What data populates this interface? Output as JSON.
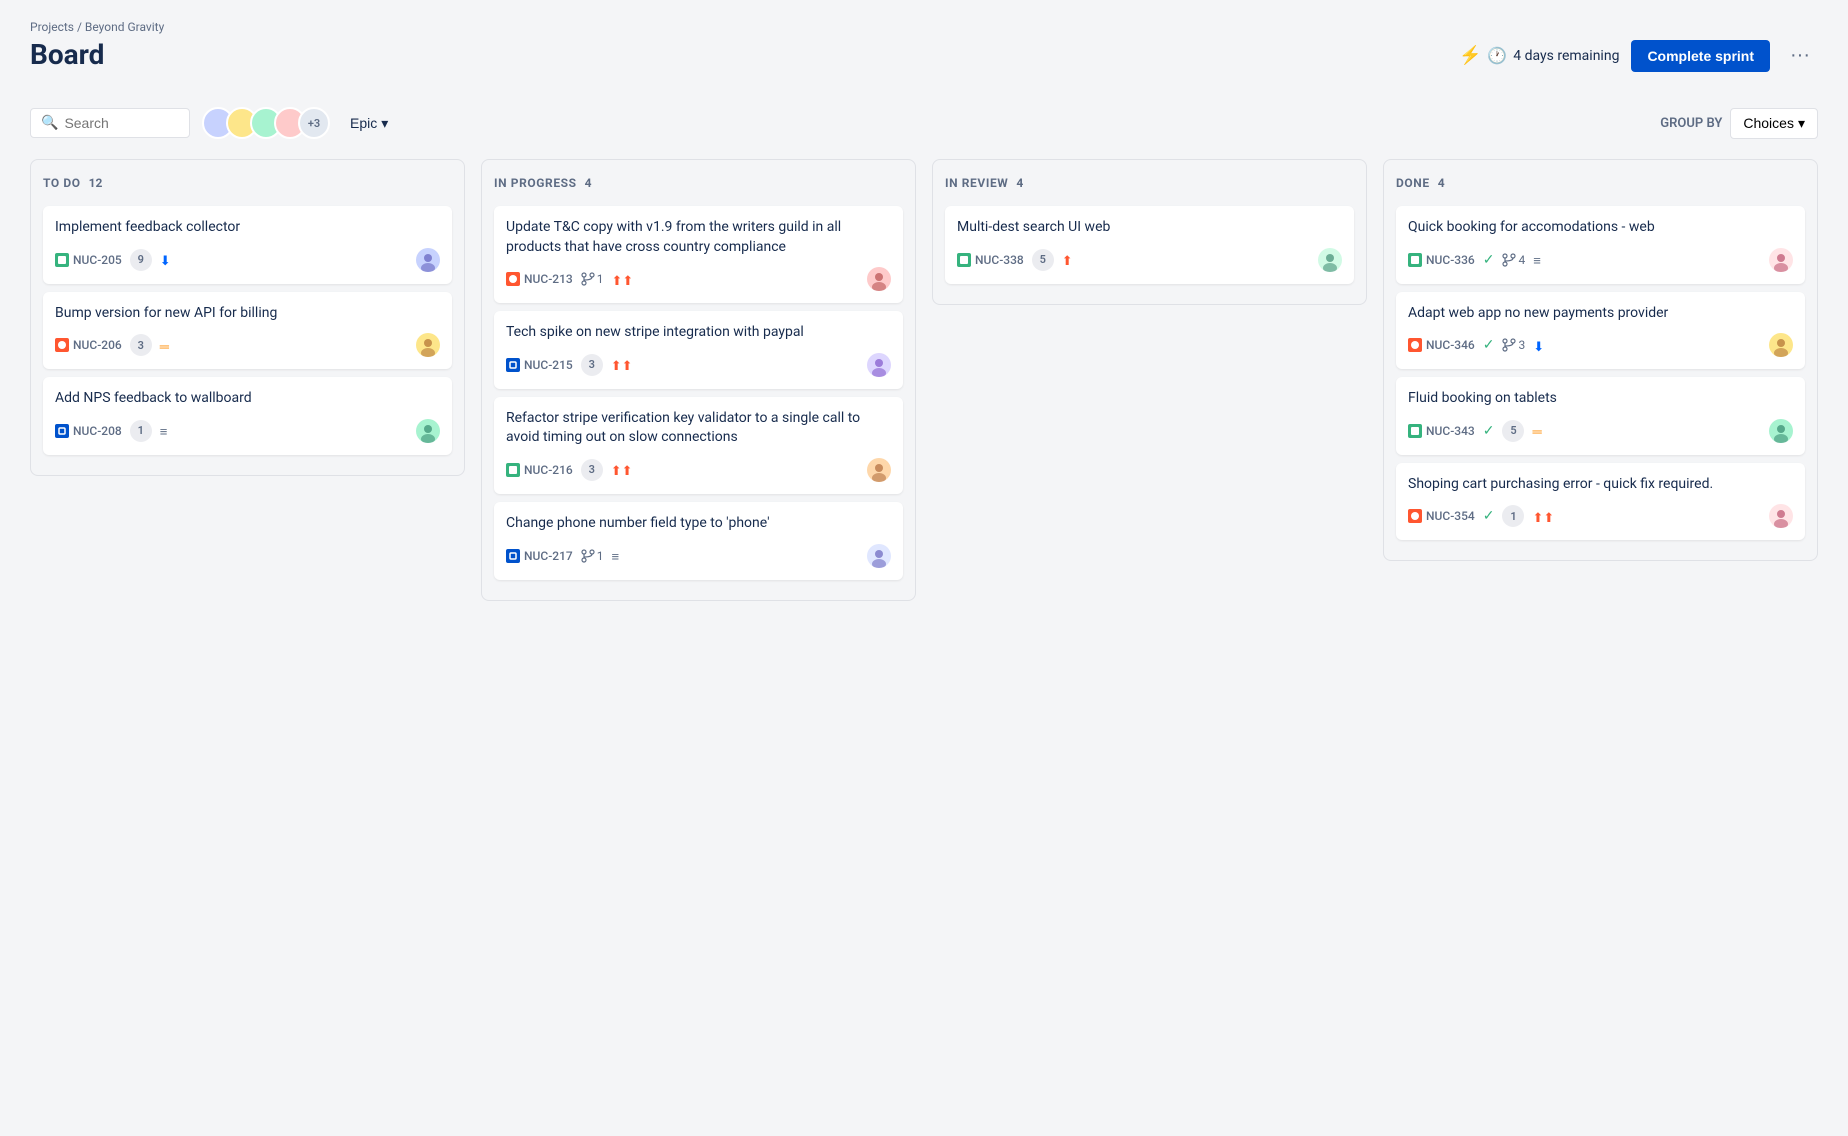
{
  "breadcrumb": "Projects / Beyond Gravity",
  "page_title": "Board",
  "sprint": {
    "days_remaining": "4 days remaining",
    "complete_btn": "Complete sprint",
    "more_btn": "···"
  },
  "toolbar": {
    "search_placeholder": "Search",
    "epic_label": "Epic",
    "group_by_label": "GROUP BY",
    "choices_label": "Choices",
    "avatar_extra": "+3"
  },
  "columns": [
    {
      "title": "TO DO",
      "count": "12",
      "cards": [
        {
          "title": "Implement feedback collector",
          "issue_id": "NUC-205",
          "issue_type": "story",
          "badge": "9",
          "priority": "low",
          "avatar": "av1"
        },
        {
          "title": "Bump version for new API for billing",
          "issue_id": "NUC-206",
          "issue_type": "bug",
          "badge": "3",
          "priority": "medium",
          "avatar": "av2"
        },
        {
          "title": "Add NPS feedback to wallboard",
          "issue_id": "NUC-208",
          "issue_type": "task",
          "badge": "1",
          "priority": "low_triple",
          "avatar": "av3"
        }
      ]
    },
    {
      "title": "IN PROGRESS",
      "count": "4",
      "cards": [
        {
          "title": "Update T&C copy with v1.9 from the writers guild in all products that have cross country compliance",
          "issue_id": "NUC-213",
          "issue_type": "bug",
          "badge": "",
          "has_branch": true,
          "branch_count": "1",
          "priority": "high",
          "avatar": "av4"
        },
        {
          "title": "Tech spike on new stripe integration with paypal",
          "issue_id": "NUC-215",
          "issue_type": "task",
          "badge": "3",
          "priority": "high",
          "avatar": "av5"
        },
        {
          "title": "Refactor stripe verification key validator to a single call to avoid timing out on slow connections",
          "issue_id": "NUC-216",
          "issue_type": "story",
          "badge": "3",
          "priority": "high",
          "avatar": "av6"
        },
        {
          "title": "Change phone number field type to 'phone'",
          "issue_id": "NUC-217",
          "issue_type": "task",
          "badge": "",
          "has_branch": true,
          "branch_count": "1",
          "priority": "low_triple",
          "avatar": "av7"
        }
      ]
    },
    {
      "title": "IN REVIEW",
      "count": "4",
      "cards": [
        {
          "title": "Multi-dest search UI web",
          "issue_id": "NUC-338",
          "issue_type": "story",
          "badge": "5",
          "priority": "high_up",
          "avatar": "av8"
        }
      ]
    },
    {
      "title": "DONE",
      "count": "4",
      "cards": [
        {
          "title": "Quick booking for accomodations - web",
          "issue_id": "NUC-336",
          "issue_type": "story",
          "has_check": true,
          "has_branch": true,
          "branch_count": "4",
          "priority": "low_triple",
          "avatar": "av9"
        },
        {
          "title": "Adapt web app no new payments provider",
          "issue_id": "NUC-346",
          "issue_type": "bug",
          "has_check": true,
          "has_branch": true,
          "branch_count": "3",
          "priority": "low",
          "avatar": "av2"
        },
        {
          "title": "Fluid booking on tablets",
          "issue_id": "NUC-343",
          "issue_type": "story",
          "has_check": true,
          "badge": "5",
          "priority": "medium",
          "avatar": "av3"
        },
        {
          "title": "Shoping cart purchasing error - quick fix required.",
          "issue_id": "NUC-354",
          "issue_type": "bug",
          "has_check": true,
          "badge": "1",
          "priority": "high",
          "avatar": "av9"
        }
      ]
    }
  ]
}
